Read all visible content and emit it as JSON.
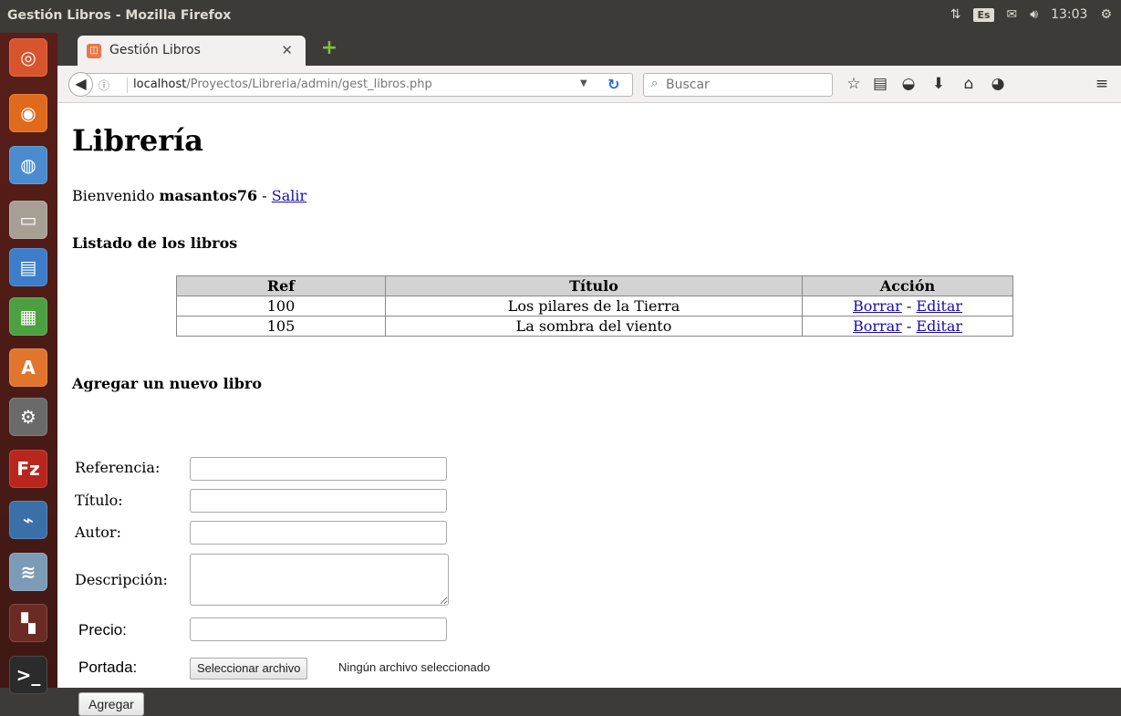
{
  "os_panel": {
    "window_title": "Gestión Libros - Mozilla Firefox",
    "keyboard_layout": "Es",
    "clock": "13:03"
  },
  "launcher": {
    "apps": [
      {
        "name": "ubuntu-dash-icon",
        "glyph": "◎",
        "color": "#d8542d"
      },
      {
        "name": "firefox-icon",
        "glyph": "◉",
        "color": "#e06a1c"
      },
      {
        "name": "chromium-icon",
        "glyph": "◍",
        "color": "#4a8ccf"
      },
      {
        "name": "files-icon",
        "glyph": "▭",
        "color": "#a89f94"
      },
      {
        "name": "writer-icon",
        "glyph": "▤",
        "color": "#3d7dc9"
      },
      {
        "name": "calc-icon",
        "glyph": "▦",
        "color": "#4ca042"
      },
      {
        "name": "software-center-icon",
        "glyph": "A",
        "color": "#e0762e"
      },
      {
        "name": "settings-icon",
        "glyph": "⚙",
        "color": "#6a6a6a"
      },
      {
        "name": "filezilla-icon",
        "glyph": "Fz",
        "color": "#b8261e"
      },
      {
        "name": "system-monitor-icon",
        "glyph": "⌁",
        "color": "#3b6fa8"
      },
      {
        "name": "mysql-workbench-icon",
        "glyph": "≋",
        "color": "#7b9bb6"
      },
      {
        "name": "workspace-switcher-icon",
        "glyph": "▚",
        "color": "#6b2a24"
      },
      {
        "name": "terminal-icon",
        "glyph": ">_",
        "color": "#2b2b2b"
      }
    ]
  },
  "browser": {
    "tab_title": "Gestión Libros",
    "url_host": "localhost",
    "url_path": "/Proyectos/Libreria/admin/gest_libros.php",
    "search_placeholder": "Buscar"
  },
  "page": {
    "title": "Librería",
    "welcome_prefix": "Bienvenido",
    "username": "masantos76",
    "separator": "-",
    "logout_link": "Salir",
    "list_heading": "Listado de los libros",
    "table": {
      "headers": [
        "Ref",
        "Título",
        "Acción"
      ],
      "rows": [
        {
          "ref": "100",
          "title": "Los pilares de la Tierra",
          "delete": "Borrar",
          "edit": "Editar"
        },
        {
          "ref": "105",
          "title": "La sombra del viento",
          "delete": "Borrar",
          "edit": "Editar"
        }
      ],
      "action_separator": "-"
    },
    "add_heading": "Agregar un nuevo libro",
    "form": {
      "ref_label": "Referencia:",
      "title_label": "Título:",
      "author_label": "Autor:",
      "description_label": "Descripción:",
      "price_label": "Precio:",
      "cover_label": "Portada:",
      "file_button": "Seleccionar archivo",
      "file_status": "Ningún archivo seleccionado",
      "submit": "Agregar"
    }
  }
}
